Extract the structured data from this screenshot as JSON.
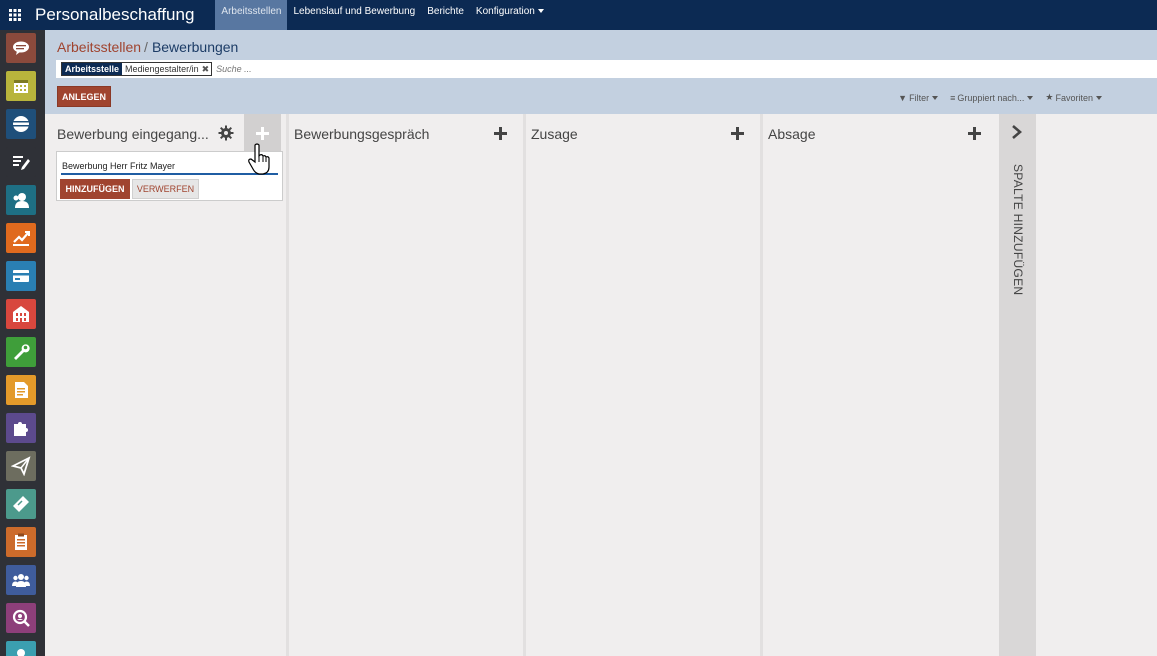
{
  "app": {
    "title": "Personalbeschaffung",
    "menu": [
      {
        "label": "Arbeitsstellen",
        "active": true
      },
      {
        "label": "Lebenslauf und Bewerbung",
        "active": false
      },
      {
        "label": "Berichte",
        "active": false
      },
      {
        "label": "Konfiguration",
        "active": false,
        "dropdown": true
      }
    ]
  },
  "sidebar": {
    "apps": [
      {
        "icon": "discuss-icon",
        "color": "#8b4a3c"
      },
      {
        "icon": "calendar-icon",
        "color": "#b8b43c"
      },
      {
        "icon": "database-icon",
        "color": "#1f4f7a"
      },
      {
        "icon": "notes-icon",
        "color": "#2f3137"
      },
      {
        "icon": "contacts-icon",
        "color": "#1e6f84"
      },
      {
        "icon": "chart-icon",
        "color": "#e06a1e"
      },
      {
        "icon": "card-icon",
        "color": "#2a7fb3"
      },
      {
        "icon": "building-icon",
        "color": "#d8473e"
      },
      {
        "icon": "wrench-icon",
        "color": "#3f9e3a"
      },
      {
        "icon": "document-icon",
        "color": "#e39a2a"
      },
      {
        "icon": "puzzle-icon",
        "color": "#5c4a8d"
      },
      {
        "icon": "send-icon",
        "color": "#6d6d5f"
      },
      {
        "icon": "ticket-icon",
        "color": "#4c9a8c"
      },
      {
        "icon": "clipboard-icon",
        "color": "#cc6b2b"
      },
      {
        "icon": "team-icon",
        "color": "#3f5c9c"
      },
      {
        "icon": "search-user-icon",
        "color": "#8d3f7a"
      },
      {
        "icon": "user-icon",
        "color": "#3b9fb0"
      }
    ]
  },
  "breadcrumb": {
    "parent": "Arbeitsstellen",
    "separator": "/",
    "current": "Bewerbungen"
  },
  "search": {
    "facet_label": "Arbeitsstelle",
    "facet_value": "Mediengestalter/in",
    "placeholder": "Suche ..."
  },
  "buttons": {
    "create": "ANLEGEN"
  },
  "search_options": {
    "filter": "Filter",
    "group_by": "Gruppiert nach...",
    "favorites": "Favoriten"
  },
  "kanban": {
    "columns": [
      {
        "title": "Bewerbung eingegang..."
      },
      {
        "title": "Bewerbungsgespräch"
      },
      {
        "title": "Zusage"
      },
      {
        "title": "Absage"
      }
    ],
    "quick_create": {
      "value": "Bewerbung Herr Fritz Mayer",
      "add_label": "HINZUFÜGEN",
      "discard_label": "VERWERFEN"
    },
    "add_column_label": "SPALTE HINZUFÜGEN"
  }
}
